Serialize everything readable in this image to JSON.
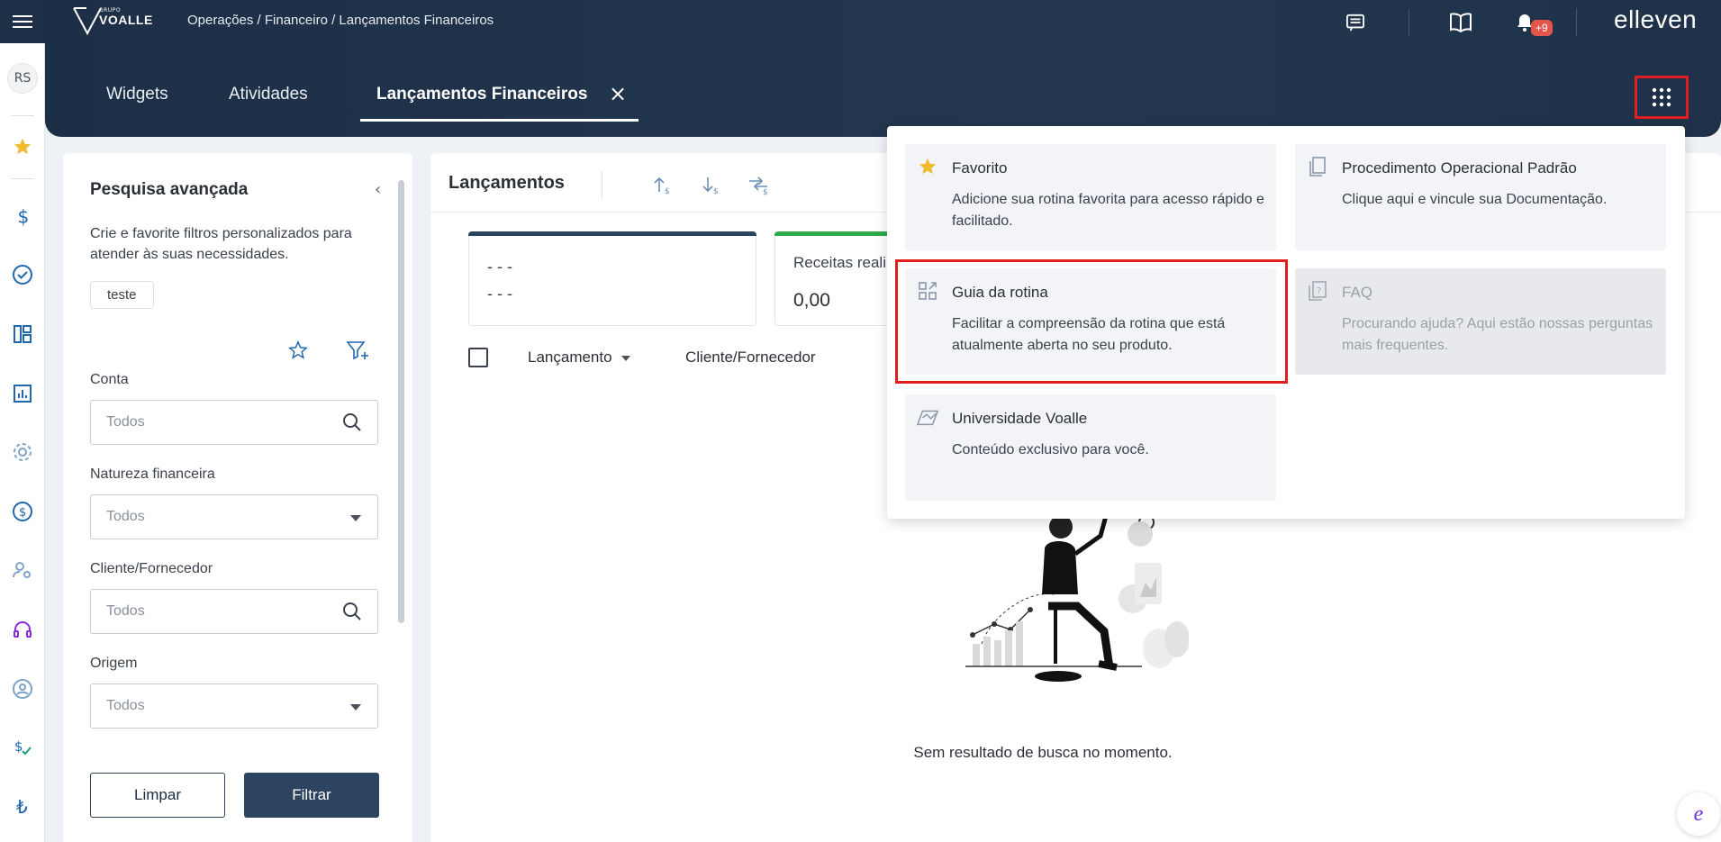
{
  "header": {
    "logo_small": "GRUPO",
    "logo_big": "VOALLE",
    "breadcrumb": "Operações / Financeiro / Lançamentos Financeiros",
    "notif_count": "+9",
    "brand": "elleven"
  },
  "rail": {
    "avatar": "RS"
  },
  "tabs": [
    {
      "label": "Widgets"
    },
    {
      "label": "Atividades"
    },
    {
      "label": "Lançamentos Financeiros",
      "active": true
    }
  ],
  "search": {
    "title": "Pesquisa avançada",
    "description": "Crie e favorite filtros personalizados para atender às suas necessidades.",
    "chip": "teste",
    "fields": [
      {
        "label": "Conta",
        "placeholder": "Todos",
        "type": "search"
      },
      {
        "label": "Natureza financeira",
        "placeholder": "Todos",
        "type": "select"
      },
      {
        "label": "Cliente/Fornecedor",
        "placeholder": "Todos",
        "type": "search"
      },
      {
        "label": "Origem",
        "placeholder": "Todos",
        "type": "select"
      }
    ],
    "clear_label": "Limpar",
    "filter_label": "Filtrar"
  },
  "main": {
    "title": "Lançamentos",
    "card1_line1": "- - -",
    "card1_line2": "- - -",
    "card2_title": "Receitas reali",
    "card2_value": "0,00",
    "col1": "Lançamento",
    "col2": "Cliente/Fornecedor",
    "empty_text": "Sem resultado de busca no momento."
  },
  "menu": {
    "items": [
      {
        "title": "Favorito",
        "desc": "Adicione sua rotina favorita para acesso rápido e facilitado.",
        "icon": "star-icon"
      },
      {
        "title": "Procedimento Operacional Padrão",
        "desc": "Clique aqui e vincule sua Documentação.",
        "icon": "document-icon"
      },
      {
        "title": "Guia da rotina",
        "desc": "Facilitar a compreensão da rotina que está atualmente aberta no seu produto.",
        "icon": "guide-icon"
      },
      {
        "title": "FAQ",
        "desc": "Procurando ajuda? Aqui estão nossas perguntas mais frequentes.",
        "icon": "faq-icon",
        "disabled": true
      },
      {
        "title": "Universidade Voalle",
        "desc": "Conteúdo exclusivo para você.",
        "icon": "university-icon"
      }
    ]
  },
  "colors": {
    "header": "#1d3048",
    "accent": "#2d4460",
    "highlight": "#e01e1e",
    "star": "#f0b92e"
  }
}
